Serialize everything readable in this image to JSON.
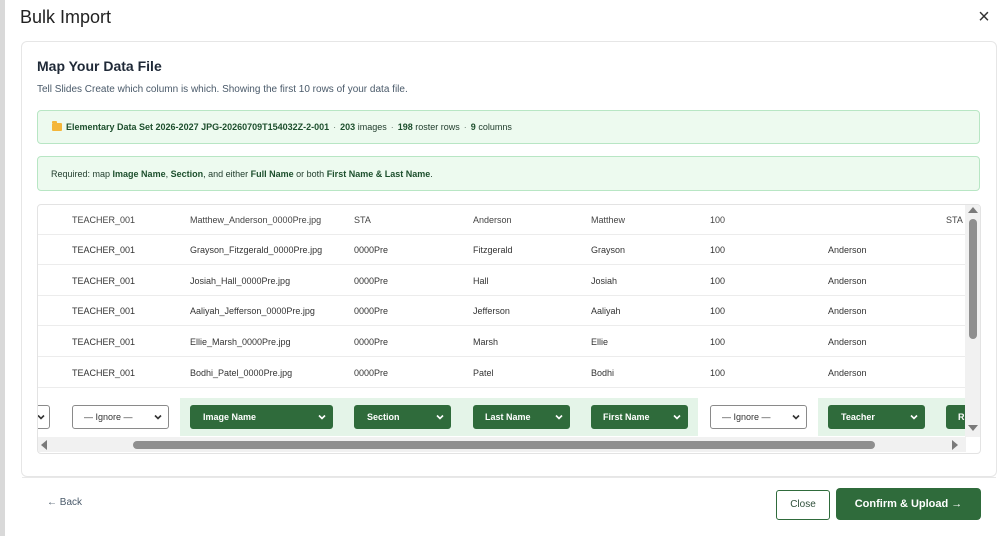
{
  "modal": {
    "title": "Bulk Import",
    "close_symbol": "×"
  },
  "card": {
    "title": "Map Your Data File",
    "subtitle": "Tell Slides Create which column is which. Showing the first 10 rows of your data file."
  },
  "info": {
    "icon": "folder-icon",
    "dataset_name": "Elementary Data Set 2026-2027 JPG-20260709T154032Z-2-001",
    "images_count": "203",
    "images_label": "images",
    "roster_count": "198",
    "roster_label": "roster rows",
    "columns_count": "9",
    "columns_label": "columns",
    "separator": "·"
  },
  "requirements": {
    "prefix": "Required: map ",
    "image_name": "Image Name",
    "comma1": ", ",
    "section": "Section",
    "middle": ", and either ",
    "full_name": "Full Name",
    "or_both": " or both ",
    "first_last": "First Name & Last Name",
    "suffix": "."
  },
  "table": {
    "header": [
      "TEACHER_001",
      "Matthew_Anderson_0000Pre.jpg",
      "STA",
      "Anderson",
      "Matthew",
      "100",
      "",
      "STA"
    ],
    "rows": [
      [
        "TEACHER_001",
        "Grayson_Fitzgerald_0000Pre.jpg",
        "0000Pre",
        "Fitzgerald",
        "Grayson",
        "100",
        "Anderson"
      ],
      [
        "TEACHER_001",
        "Josiah_Hall_0000Pre.jpg",
        "0000Pre",
        "Hall",
        "Josiah",
        "100",
        "Anderson"
      ],
      [
        "TEACHER_001",
        "Aaliyah_Jefferson_0000Pre.jpg",
        "0000Pre",
        "Jefferson",
        "Aaliyah",
        "100",
        "Anderson"
      ],
      [
        "TEACHER_001",
        "Ellie_Marsh_0000Pre.jpg",
        "0000Pre",
        "Marsh",
        "Ellie",
        "100",
        "Anderson"
      ],
      [
        "TEACHER_001",
        "Bodhi_Patel_0000Pre.jpg",
        "0000Pre",
        "Patel",
        "Bodhi",
        "100",
        "Anderson"
      ]
    ],
    "mappings": [
      "— Ignore —",
      "Image Name",
      "Section",
      "Last Name",
      "First Name",
      "— Ignore —",
      "Teacher",
      "R"
    ]
  },
  "footer": {
    "back_label": "← Back",
    "close_label": "Close",
    "confirm_label": "Confirm & Upload →"
  },
  "colors": {
    "accent_green": "#2f6b3b",
    "info_bg": "#edfaef",
    "info_border": "#b8e6c4",
    "mapped_bg": "#e4f4e8"
  }
}
